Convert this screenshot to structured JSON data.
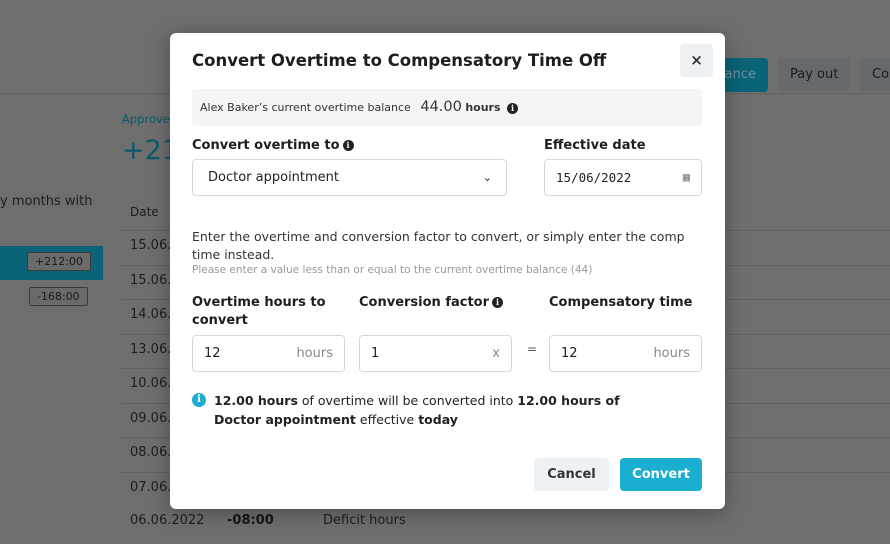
{
  "background": {
    "link": "Approve",
    "big_number": "+21",
    "side_text": "y months with",
    "date_header": "Date",
    "buttons": [
      "ance",
      "Pay out",
      "Co"
    ],
    "chips": [
      "+212:00",
      "-168:00"
    ],
    "rows": [
      "15.06.2",
      "15.06.2",
      "14.06.2",
      "13.06.2",
      "10.06.2",
      "09.06.2",
      "08.06.2",
      "07.06.2"
    ],
    "last_row": {
      "date": "06.06.2022",
      "value": "-08:00",
      "type": "Deficit hours"
    }
  },
  "modal": {
    "title": "Convert Overtime to Compensatory Time Off",
    "close": "×",
    "balance": {
      "label": "Alex Baker’s current overtime balance",
      "value": "44.00",
      "unit": "hours"
    },
    "convert_to": {
      "label": "Convert overtime to",
      "value": "Doctor appointment"
    },
    "effective_date": {
      "label": "Effective date",
      "value": "15/06/2022"
    },
    "instructions": "Enter the overtime and conversion factor to convert, or simply enter the comp time instead.",
    "hint": "Please enter a value less than or equal to the current overtime balance (44)",
    "overtime_hours": {
      "label": "Overtime hours to convert",
      "value": "12",
      "suffix": "hours"
    },
    "conversion_factor": {
      "label": "Conversion factor",
      "value": "1",
      "suffix": "x"
    },
    "equals": "=",
    "comp_time": {
      "label": "Compensatory time",
      "value": "12",
      "suffix": "hours"
    },
    "message": {
      "p1": "12.00 hours",
      "p2": " of overtime will be converted into ",
      "p3": "12.00 hours of Doctor appointment",
      "p4": " effective ",
      "p5": "today"
    },
    "cancel": "Cancel",
    "convert": "Convert"
  },
  "colors": {
    "accent": "#1aafd0",
    "teal": "#0e7d95"
  }
}
